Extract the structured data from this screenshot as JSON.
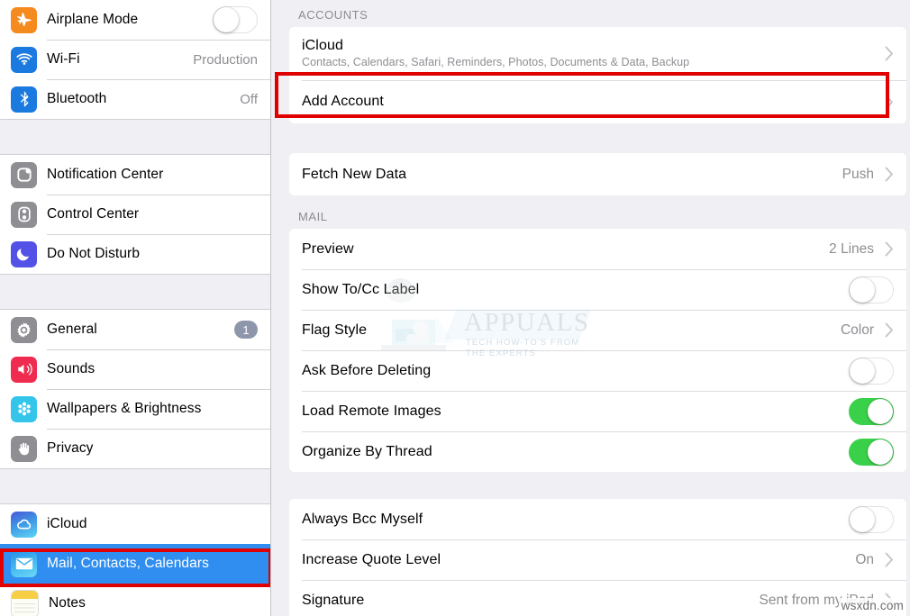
{
  "sidebar": {
    "groups": [
      {
        "rows": [
          {
            "label": "Airplane Mode",
            "icon": "airplane-icon",
            "control": "switch",
            "on": false
          },
          {
            "label": "Wi-Fi",
            "icon": "wifi-icon",
            "control": "value",
            "value": "Production"
          },
          {
            "label": "Bluetooth",
            "icon": "bluetooth-icon",
            "control": "value",
            "value": "Off"
          }
        ]
      },
      {
        "rows": [
          {
            "label": "Notification Center",
            "icon": "notification-center-icon",
            "control": "none"
          },
          {
            "label": "Control Center",
            "icon": "control-center-icon",
            "control": "none"
          },
          {
            "label": "Do Not Disturb",
            "icon": "do-not-disturb-icon",
            "control": "none"
          }
        ]
      },
      {
        "rows": [
          {
            "label": "General",
            "icon": "gear-icon",
            "control": "badge",
            "badge": "1"
          },
          {
            "label": "Sounds",
            "icon": "sounds-icon",
            "control": "none"
          },
          {
            "label": "Wallpapers & Brightness",
            "icon": "wallpapers-icon",
            "control": "none"
          },
          {
            "label": "Privacy",
            "icon": "privacy-hand-icon",
            "control": "none"
          }
        ]
      },
      {
        "rows": [
          {
            "label": "iCloud",
            "icon": "icloud-icon",
            "control": "none"
          },
          {
            "label": "Mail, Contacts, Calendars",
            "icon": "mail-icon",
            "control": "none",
            "selected": true
          },
          {
            "label": "Notes",
            "icon": "notes-icon",
            "control": "none"
          }
        ]
      }
    ]
  },
  "content": {
    "accounts_header": "ACCOUNTS",
    "accounts": [
      {
        "title": "iCloud",
        "subtitle": "Contacts, Calendars, Safari, Reminders, Photos, Documents & Data, Backup",
        "accessory": "chevron"
      },
      {
        "title": "Add Account",
        "accessory": "chevron",
        "highlighted": true
      }
    ],
    "fetch": {
      "title": "Fetch New Data",
      "value": "Push",
      "accessory": "chevron"
    },
    "mail_header": "MAIL",
    "mail_rows": [
      {
        "title": "Preview",
        "control": "value",
        "value": "2 Lines",
        "accessory": "chevron"
      },
      {
        "title": "Show To/Cc Label",
        "control": "switch",
        "on": false
      },
      {
        "title": "Flag Style",
        "control": "value",
        "value": "Color",
        "accessory": "chevron"
      },
      {
        "title": "Ask Before Deleting",
        "control": "switch",
        "on": false
      },
      {
        "title": "Load Remote Images",
        "control": "switch",
        "on": true
      },
      {
        "title": "Organize By Thread",
        "control": "switch",
        "on": true
      }
    ],
    "compose_rows": [
      {
        "title": "Always Bcc Myself",
        "control": "switch",
        "on": false
      },
      {
        "title": "Increase Quote Level",
        "control": "value",
        "value": "On",
        "accessory": "chevron"
      },
      {
        "title": "Signature",
        "control": "value",
        "value": "Sent from my iPad",
        "accessory": "chevron"
      }
    ]
  },
  "watermarks": {
    "appuals_title": "APPUALS",
    "appuals_line1": "TECH HOW-TO'S FROM",
    "appuals_line2": "THE EXPERTS",
    "site": "wsxdn.com"
  },
  "colors": {
    "selection_blue": "#2f8ef0",
    "highlight_red": "#e00000",
    "switch_on_green": "#3ad14a",
    "panel_gray": "#efeff4",
    "badge_gray": "#8e96ab"
  }
}
